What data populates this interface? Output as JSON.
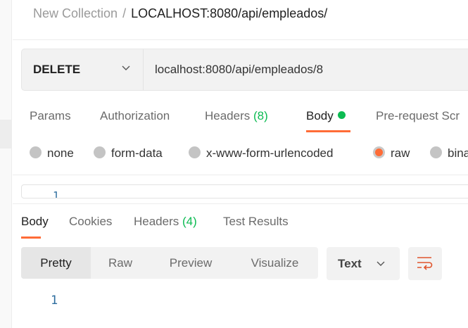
{
  "breadcrumb": {
    "collection": "New Collection",
    "separator": "/",
    "request": "LOCALHOST:8080/api/empleados/"
  },
  "request": {
    "method": "DELETE",
    "url": "localhost:8080/api/empleados/8"
  },
  "request_tabs": [
    {
      "label": "Params"
    },
    {
      "label": "Authorization"
    },
    {
      "label": "Headers",
      "count": "(8)"
    },
    {
      "label": "Body"
    },
    {
      "label": "Pre-request Scr"
    }
  ],
  "body_types": [
    {
      "label": "none"
    },
    {
      "label": "form-data"
    },
    {
      "label": "x-www-form-urlencoded"
    },
    {
      "label": "raw",
      "selected": true
    },
    {
      "label": "bina"
    }
  ],
  "request_editor": {
    "line_number": "1"
  },
  "response_tabs": [
    {
      "label": "Body"
    },
    {
      "label": "Cookies"
    },
    {
      "label": "Headers",
      "count": "(4)"
    },
    {
      "label": "Test Results"
    }
  ],
  "view_modes": [
    {
      "label": "Pretty",
      "selected": true
    },
    {
      "label": "Raw"
    },
    {
      "label": "Preview"
    },
    {
      "label": "Visualize"
    }
  ],
  "format": {
    "selected": "Text"
  },
  "response": {
    "line_number": "1"
  },
  "colors": {
    "accent": "#ff6c37",
    "green": "#0cbb52"
  }
}
